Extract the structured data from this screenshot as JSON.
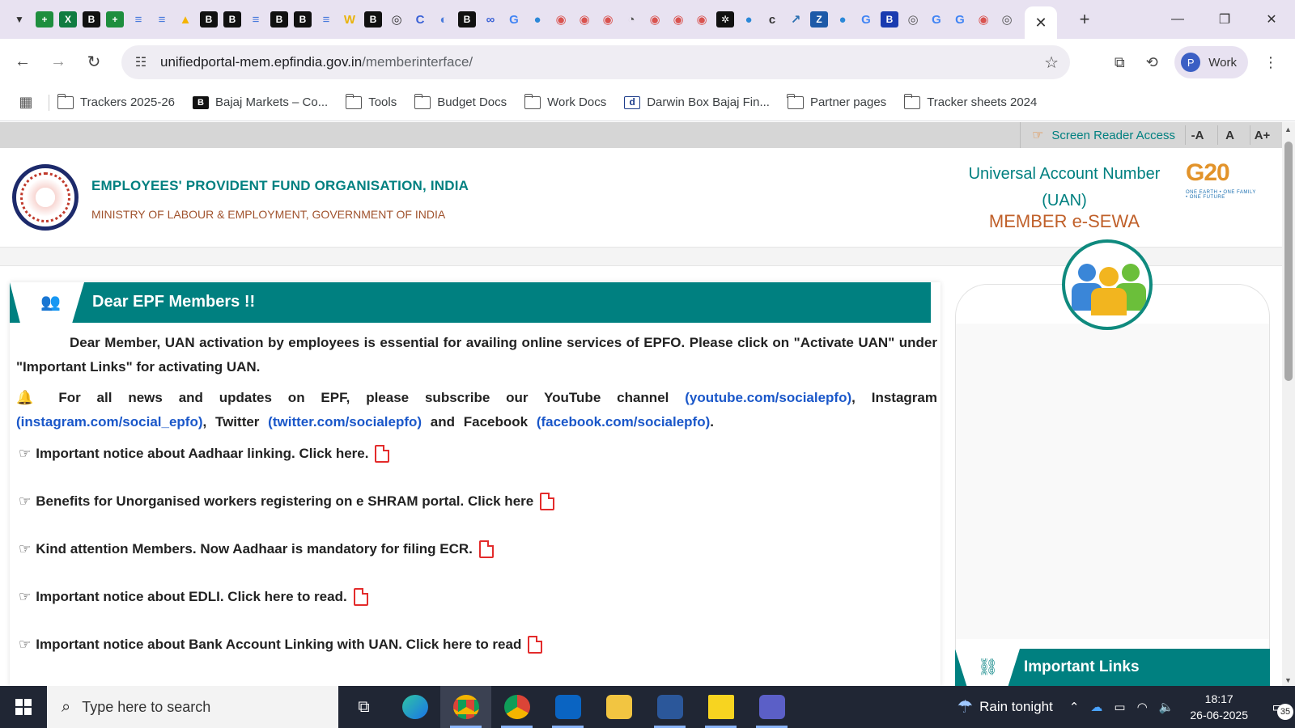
{
  "browser": {
    "tab_favicons": [
      {
        "icon": "sheets-plus-icon",
        "glyph": "+",
        "color": "#1e8e3e"
      },
      {
        "icon": "excel-icon",
        "glyph": "X",
        "color": "#107c41"
      },
      {
        "icon": "bajaj-b-icon",
        "glyph": "B",
        "color": "#111111"
      },
      {
        "icon": "sheets-plus-icon",
        "glyph": "+",
        "color": "#1e8e3e"
      },
      {
        "icon": "forms-icon",
        "glyph": "≡",
        "color": "#4a7bdc"
      },
      {
        "icon": "forms-icon",
        "glyph": "≡",
        "color": "#4a7bdc"
      },
      {
        "icon": "drive-icon",
        "glyph": "▲",
        "color": "#f4b400"
      },
      {
        "icon": "bajaj-b-icon",
        "glyph": "B",
        "color": "#111111"
      },
      {
        "icon": "bajaj-b-icon",
        "glyph": "B",
        "color": "#111111"
      },
      {
        "icon": "forms-icon",
        "glyph": "≡",
        "color": "#4a7bdc"
      },
      {
        "icon": "bajaj-b-icon",
        "glyph": "B",
        "color": "#111111"
      },
      {
        "icon": "bajaj-b-icon",
        "glyph": "B",
        "color": "#111111"
      },
      {
        "icon": "forms-icon",
        "glyph": "≡",
        "color": "#4a7bdc"
      },
      {
        "icon": "w-icon",
        "glyph": "W",
        "color": "#e9b30c"
      },
      {
        "icon": "bajaj-b-icon",
        "glyph": "B",
        "color": "#111111"
      },
      {
        "icon": "openai-icon",
        "glyph": "◎",
        "color": "#333333"
      },
      {
        "icon": "c-icon",
        "glyph": "C",
        "color": "#3b62d6"
      },
      {
        "icon": "globe-icon",
        "glyph": "◐",
        "color": "#4a7bdc"
      },
      {
        "icon": "bajaj-b-icon",
        "glyph": "B",
        "color": "#111111"
      },
      {
        "icon": "link-icon",
        "glyph": "∞",
        "color": "#3b62d6"
      },
      {
        "icon": "google-icon",
        "glyph": "G",
        "color": "#4285f4"
      },
      {
        "icon": "copilot-icon",
        "glyph": "●",
        "color": "#2b88d8"
      },
      {
        "icon": "target-icon",
        "glyph": "◉",
        "color": "#d9534f"
      },
      {
        "icon": "target-icon",
        "glyph": "◉",
        "color": "#d9534f"
      },
      {
        "icon": "target-icon",
        "glyph": "◉",
        "color": "#d9534f"
      },
      {
        "icon": "spiral-icon",
        "glyph": "◔",
        "color": "#555555"
      },
      {
        "icon": "target-icon",
        "glyph": "◉",
        "color": "#d9534f"
      },
      {
        "icon": "target-icon",
        "glyph": "◉",
        "color": "#d9534f"
      },
      {
        "icon": "target-icon",
        "glyph": "◉",
        "color": "#d9534f"
      },
      {
        "icon": "star-burst-icon",
        "glyph": "✲",
        "color": "#111111"
      },
      {
        "icon": "copilot-icon",
        "glyph": "●",
        "color": "#2b88d8"
      },
      {
        "icon": "clear-icon",
        "glyph": "c",
        "color": "#333333"
      },
      {
        "icon": "chart-icon",
        "glyph": "↗",
        "color": "#2a6fb0"
      },
      {
        "icon": "z-icon",
        "glyph": "Z",
        "color": "#1e5aa8"
      },
      {
        "icon": "copilot-icon",
        "glyph": "●",
        "color": "#2b88d8"
      },
      {
        "icon": "google-icon",
        "glyph": "G",
        "color": "#4285f4"
      },
      {
        "icon": "b-blue-icon",
        "glyph": "B",
        "color": "#1a3bb0"
      },
      {
        "icon": "chrome-icon",
        "glyph": "◎",
        "color": "#555555"
      },
      {
        "icon": "google-icon",
        "glyph": "G",
        "color": "#4285f4"
      },
      {
        "icon": "google-icon",
        "glyph": "G",
        "color": "#4285f4"
      },
      {
        "icon": "target-icon",
        "glyph": "◉",
        "color": "#d9534f"
      },
      {
        "icon": "chrome-icon",
        "glyph": "◎",
        "color": "#555555"
      }
    ],
    "url_host": "unifiedportal-mem.epfindia.gov.in",
    "url_path": "/memberinterface/",
    "profile_initial": "P",
    "profile_name": "Work",
    "bookmarks": [
      {
        "label": "Trackers 2025-26",
        "icon": "folder"
      },
      {
        "label": "Bajaj Markets – Co...",
        "icon": "bajaj"
      },
      {
        "label": "Tools",
        "icon": "folder"
      },
      {
        "label": "Budget Docs",
        "icon": "folder"
      },
      {
        "label": "Work Docs",
        "icon": "folder"
      },
      {
        "label": "Darwin Box Bajaj Fin...",
        "icon": "darwin"
      },
      {
        "label": "Partner pages",
        "icon": "folder"
      },
      {
        "label": "Tracker sheets 2024",
        "icon": "folder"
      }
    ]
  },
  "accessibility": {
    "screen_reader": "Screen Reader Access",
    "font_decrease": "-A",
    "font_normal": "A",
    "font_increase": "A+"
  },
  "header": {
    "org_name": "EMPLOYEES' PROVIDENT FUND ORGANISATION, INDIA",
    "ministry": "MINISTRY OF LABOUR & EMPLOYMENT, GOVERNMENT OF INDIA",
    "uan_line1": "Universal Account Number",
    "uan_line2": "(UAN)",
    "member_esewa": "MEMBER e-SEWA",
    "g20_mark": "G20",
    "g20_tagline": "ONE EARTH • ONE FAMILY • ONE FUTURE"
  },
  "notice_panel": {
    "title": "Dear EPF Members !!",
    "intro": "Dear Member, UAN activation by employees is essential for availing online services of EPFO. Please click on \"Activate UAN\" under \"Important Links\" for activating UAN.",
    "news_prefix": "For all news and updates on EPF, please subscribe our YouTube channel",
    "youtube": "(youtube.com/socialepfo)",
    "instagram_label": ", Instagram",
    "instagram": "(instagram.com/social_epfo)",
    "twitter_label": ", Twitter",
    "twitter": "(twitter.com/socialepfo)",
    "facebook_label": "and Facebook",
    "facebook": "(facebook.com/socialepfo)",
    "notices": [
      "Important notice about Aadhaar linking. Click here.",
      "Benefits for Unorganised workers registering on e SHRAM portal. Click here",
      "Kind attention Members. Now Aadhaar is mandatory for filing ECR.",
      "Important notice about EDLI. Click here to read.",
      "Important notice about Bank Account Linking with UAN. Click here to read"
    ]
  },
  "side_panel": {
    "important_links": "Important Links"
  },
  "taskbar": {
    "search_placeholder": "Type here to search",
    "weather": "Rain tonight",
    "time": "18:17",
    "date": "26-06-2025",
    "notification_count": "35"
  }
}
